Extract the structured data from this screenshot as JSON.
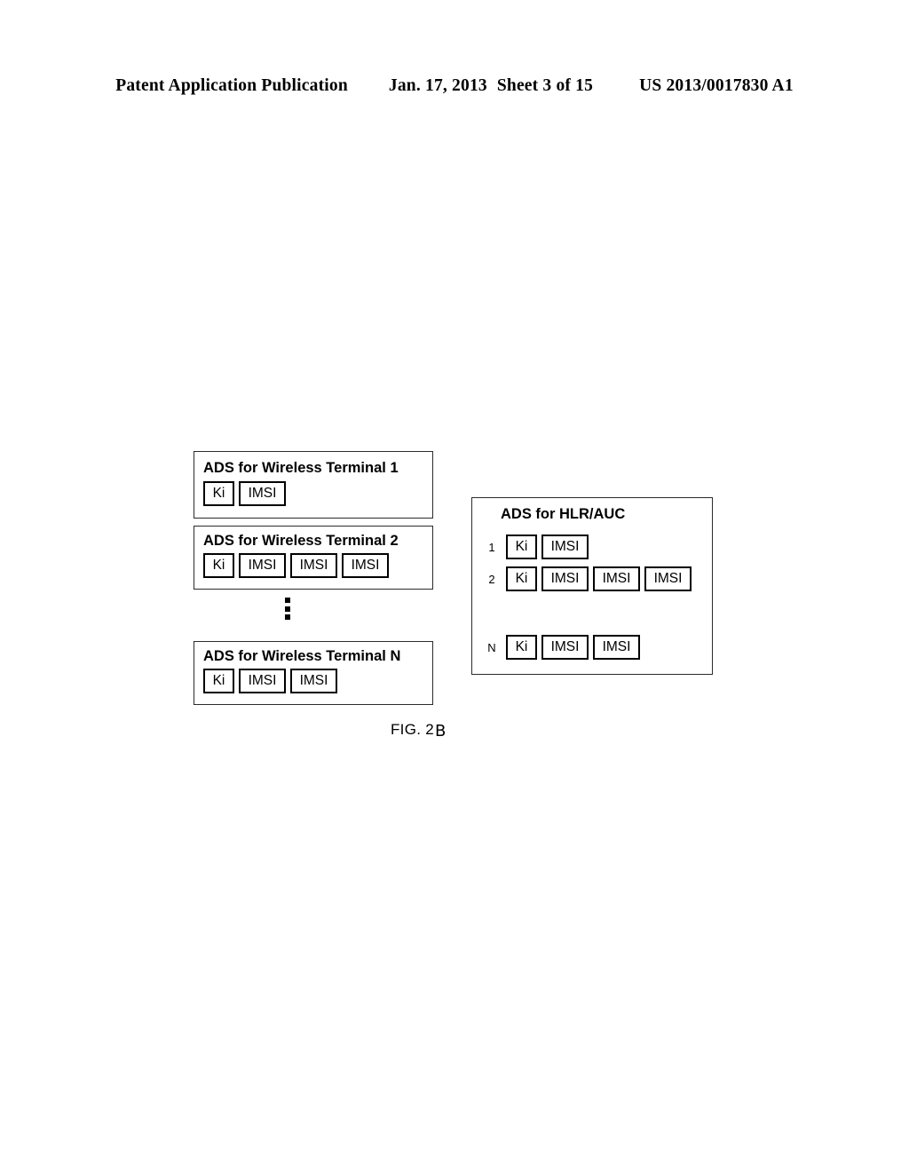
{
  "header": {
    "publication": "Patent Application Publication",
    "date": "Jan. 17, 2013",
    "sheet": "Sheet 3 of 15",
    "patent_number": "US 2013/0017830 A1"
  },
  "figure": {
    "caption_prefix": "FIG. 2",
    "caption_letter": "B",
    "ellipsis_glyph": "⋮",
    "terminal_boxes": [
      {
        "title": "ADS for Wireless Terminal 1",
        "cells": [
          "Ki",
          "IMSI"
        ]
      },
      {
        "title": "ADS for Wireless Terminal 2",
        "cells": [
          "Ki",
          "IMSI",
          "IMSI",
          "IMSI"
        ]
      },
      {
        "title": "ADS for Wireless Terminal N",
        "cells": [
          "Ki",
          "IMSI",
          "IMSI"
        ]
      }
    ],
    "hlr_box": {
      "title": "ADS for HLR/AUC",
      "rows": [
        {
          "index": "1",
          "cells": [
            "Ki",
            "IMSI"
          ]
        },
        {
          "index": "2",
          "cells": [
            "Ki",
            "IMSI",
            "IMSI",
            "IMSI"
          ]
        },
        {
          "index": "N",
          "cells": [
            "Ki",
            "IMSI",
            "IMSI"
          ]
        }
      ]
    }
  },
  "colors": {
    "ink": "#000000",
    "box_border": "#2b2b2b",
    "page_background": "#ffffff"
  }
}
